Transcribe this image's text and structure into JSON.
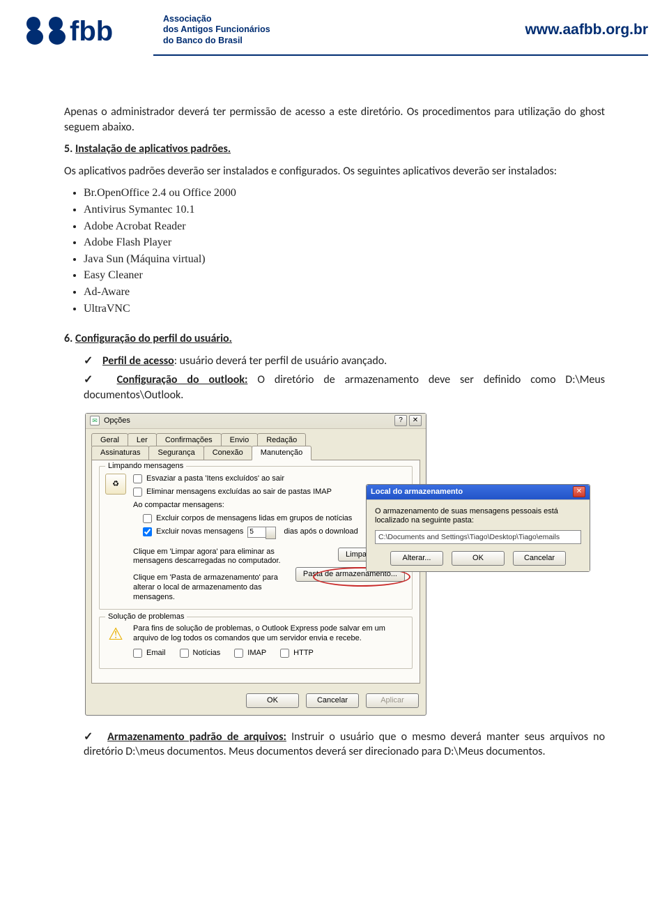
{
  "header": {
    "org_line1": "Associação",
    "org_line2": "dos Antigos Funcionários",
    "org_line3": "do Banco do Brasil",
    "url": "www.aafbb.org.br"
  },
  "body": {
    "p1": "Apenas o administrador deverá ter permissão de acesso a este diretório. Os procedimentos para utilização do ghost seguem abaixo.",
    "h5_num": "5.",
    "h5": "Instalação de aplicativos padrões.",
    "p2": "Os aplicativos padrões deverão ser instalados e configurados. Os seguintes aplicativos deverão ser instalados:",
    "apps": [
      "Br.OpenOffice 2.4 ou Office 2000",
      "Antivirus Symantec 10.1",
      "Adobe Acrobat Reader",
      "Adobe Flash Player",
      "Java Sun (Máquina virtual)",
      "Easy Cleaner",
      "Ad-Aware",
      "UltraVNC"
    ],
    "h6_num": "6.",
    "h6": "Configuração do perfil do usuário.",
    "chk1_label": "Perfil de acesso",
    "chk1_rest": ": usuário deverá ter perfil de usuário avançado.",
    "chk2_label": "Configuração do outlook:",
    "chk2_rest": " O diretório de armazenamento deve ser definido como D:\\Meus documentos\\Outlook.",
    "chk3_label": "Armazenamento padrão de arquivos:",
    "chk3_rest": " Instruir o usuário que o mesmo deverá manter seus arquivos no diretório D:\\meus documentos. Meus documentos deverá ser direcionado para D:\\Meus documentos."
  },
  "shot": {
    "options_title": "Opções",
    "tabs_row1": [
      "Geral",
      "Ler",
      "Confirmações",
      "Envio",
      "Redação"
    ],
    "tabs_row2": [
      "Assinaturas",
      "Segurança",
      "Conexão",
      "Manutenção"
    ],
    "grp1_legend": "Limpando mensagens",
    "cb1": "Esvaziar a pasta 'Itens excluídos' ao sair",
    "cb2": "Eliminar mensagens excluídas ao sair de pastas IMAP",
    "compact_label": "Ao compactar mensagens:",
    "cb3": "Excluir corpos de mensagens lidas em grupos de notícias",
    "cb4": "Excluir novas mensagens",
    "spin_val": "5",
    "after_days": "dias após o download",
    "left_text1": "Clique em 'Limpar agora' para eliminar as mensagens descarregadas no computador.",
    "left_text2": "Clique em 'Pasta de armazenamento' para alterar o local de armazenamento das mensagens.",
    "btn_clean": "Limpar agora...",
    "btn_store": "Pasta de armazenamento...",
    "grp2_legend": "Solução de problemas",
    "grp2_text": "Para fins de solução de problemas, o Outlook Express pode salvar em um arquivo de log todos os comandos que um servidor envia e recebe.",
    "log1": "Email",
    "log2": "Notícias",
    "log3": "IMAP",
    "log4": "HTTP",
    "ok": "OK",
    "cancel": "Cancelar",
    "apply": "Aplicar",
    "storage_title": "Local do armazenamento",
    "storage_text": "O armazenamento de suas mensagens pessoais está localizado na seguinte pasta:",
    "storage_path": "C:\\Documents and Settings\\Tiago\\Desktop\\Tiago\\emails",
    "alterar": "Alterar..."
  }
}
